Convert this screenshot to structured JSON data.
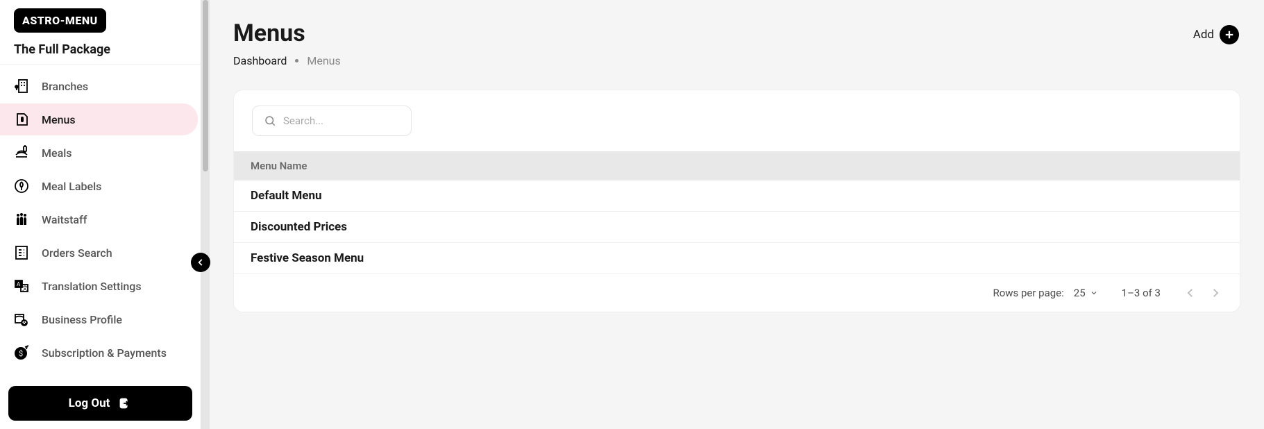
{
  "logo": "ASTRO-MENU",
  "business_name": "The Full Package",
  "sidebar": {
    "items": [
      {
        "label": "Branches"
      },
      {
        "label": "Menus"
      },
      {
        "label": "Meals"
      },
      {
        "label": "Meal Labels"
      },
      {
        "label": "Waitstaff"
      },
      {
        "label": "Orders Search"
      },
      {
        "label": "Translation Settings"
      },
      {
        "label": "Business Profile"
      },
      {
        "label": "Subscription & Payments"
      }
    ]
  },
  "logout_label": "Log Out",
  "page": {
    "title": "Menus",
    "breadcrumb": {
      "root": "Dashboard",
      "current": "Menus"
    },
    "add_label": "Add"
  },
  "search": {
    "placeholder": "Search..."
  },
  "table": {
    "header": "Menu Name",
    "rows": [
      {
        "name": "Default Menu"
      },
      {
        "name": "Discounted Prices"
      },
      {
        "name": "Festive Season Menu"
      }
    ]
  },
  "pagination": {
    "rows_label": "Rows per page:",
    "page_size": "25",
    "range": "1–3 of 3"
  }
}
